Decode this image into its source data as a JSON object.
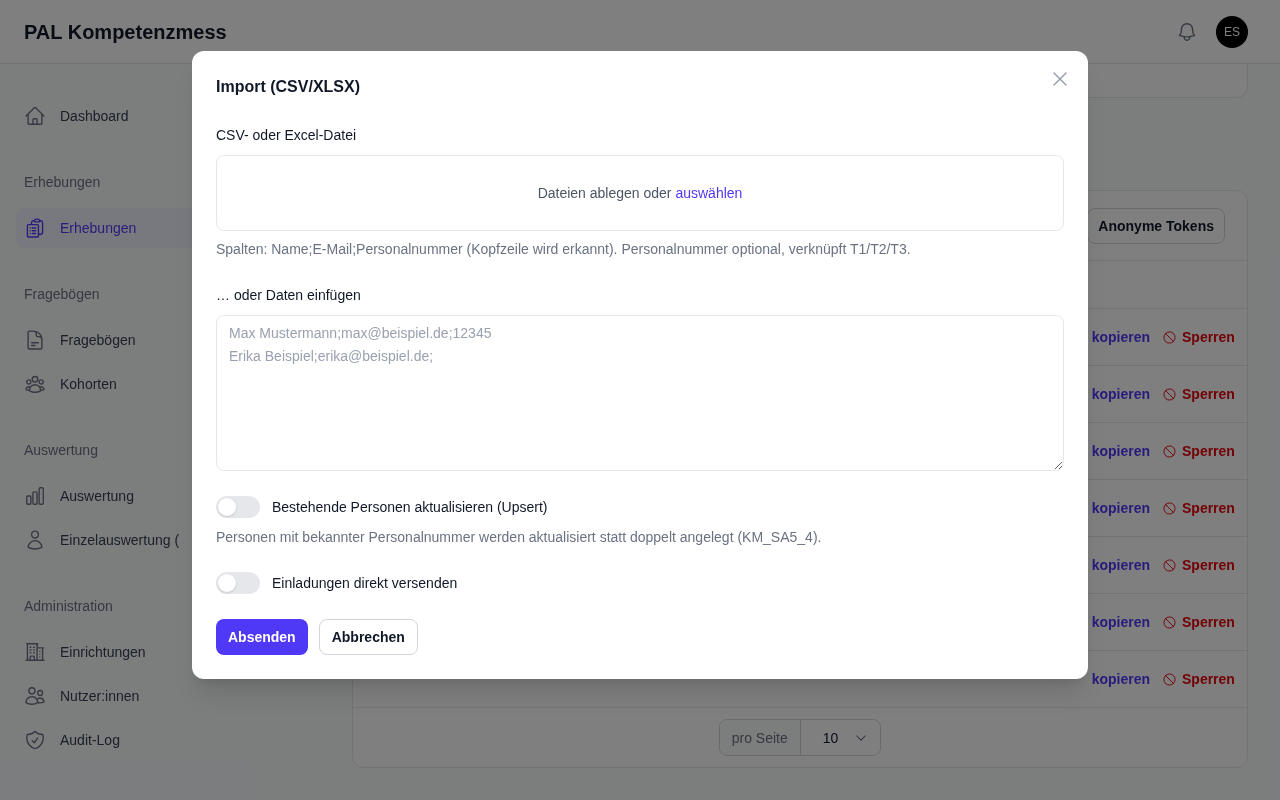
{
  "header": {
    "title": "PAL Kompetenzmess",
    "avatar": "ES"
  },
  "sidebar": [
    {
      "kind": "item",
      "label": "Dashboard",
      "selected": false
    },
    {
      "kind": "heading",
      "label": "Erhebungen"
    },
    {
      "kind": "item",
      "label": "Erhebungen",
      "selected": true
    },
    {
      "kind": "heading",
      "label": "Fragebögen"
    },
    {
      "kind": "item",
      "label": "Fragebögen",
      "selected": false
    },
    {
      "kind": "item",
      "label": "Kohorten",
      "selected": false
    },
    {
      "kind": "heading",
      "label": "Auswertung"
    },
    {
      "kind": "item",
      "label": "Auswertung",
      "selected": false
    },
    {
      "kind": "item",
      "label": "Einzelauswertung (",
      "selected": false
    },
    {
      "kind": "heading",
      "label": "Administration"
    },
    {
      "kind": "item",
      "label": "Einrichtungen",
      "selected": false
    },
    {
      "kind": "item",
      "label": "Nutzer:innen",
      "selected": false
    },
    {
      "kind": "item",
      "label": "Audit-Log",
      "selected": false
    }
  ],
  "table": {
    "toolbar_button": "Anonyme Tokens",
    "rows": [
      {
        "link": "kopieren",
        "action": "Sperren"
      },
      {
        "link": "kopieren",
        "action": "Sperren"
      },
      {
        "link": "kopieren",
        "action": "Sperren"
      },
      {
        "link": "kopieren",
        "action": "Sperren"
      },
      {
        "link": "kopieren",
        "action": "Sperren"
      },
      {
        "link": "kopieren",
        "action": "Sperren"
      },
      {
        "link": "kopieren",
        "action": "Sperren"
      }
    ],
    "pagination": {
      "label": "pro Seite",
      "value": "10"
    }
  },
  "dialog": {
    "title": "Import (CSV/XLSX)",
    "file_label": "CSV- oder Excel-Datei",
    "dropzone": {
      "text": "Dateien ablegen oder",
      "link": "auswählen"
    },
    "file_hint": "Spalten: Name;E-Mail;Personalnummer (Kopfzeile wird erkannt). Personalnummer optional, verknüpft T1/T2/T3.",
    "paste_label": "… oder Daten einfügen",
    "paste_field": {
      "placeholder": "Max Mustermann;max@beispiel.de;12345\nErika Beispiel;erika@beispiel.de;"
    },
    "options": [
      {
        "label": "Bestehende Personen aktualisieren (Upsert)",
        "on": false,
        "hint": "Personen mit bekannter Personalnummer werden aktualisiert statt doppelt angelegt (KM_SA5_4)."
      },
      {
        "label": "Einladungen direkt versenden",
        "on": false
      }
    ],
    "buttons": [
      {
        "kind": "primary",
        "label": "Absenden"
      },
      {
        "kind": "secondary",
        "label": "Abbrechen"
      }
    ]
  }
}
